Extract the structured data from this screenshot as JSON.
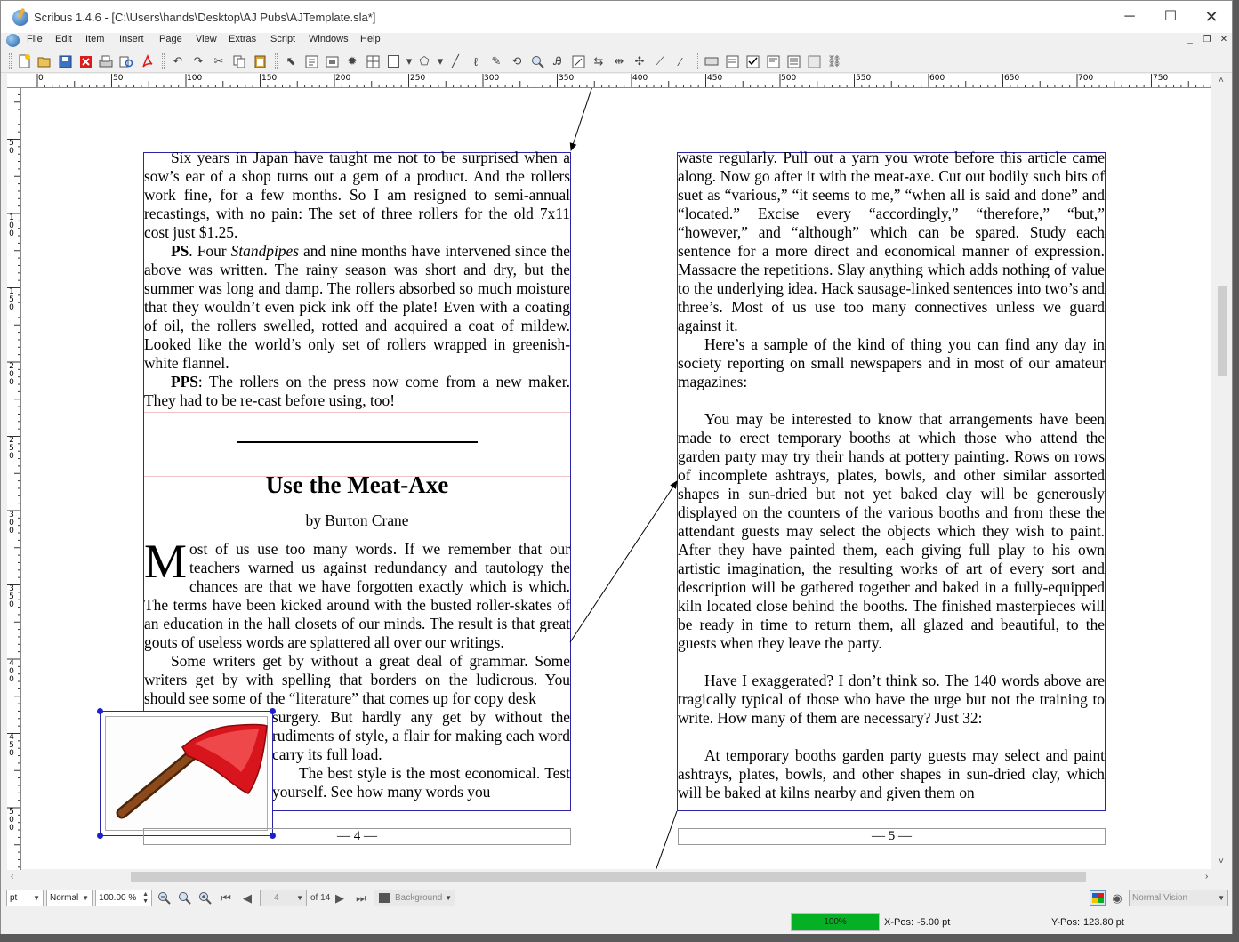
{
  "window": {
    "title": "Scribus 1.4.6 - [C:\\Users\\hands\\Desktop\\AJ Pubs\\AJTemplate.sla*]",
    "min": "─",
    "max": "☐",
    "close": "✕"
  },
  "menu": [
    "File",
    "Edit",
    "Item",
    "Insert",
    "Page",
    "View",
    "Extras",
    "Script",
    "Windows",
    "Help"
  ],
  "mdi": {
    "min": "_",
    "restore": "❐",
    "close": "✕"
  },
  "ruler": {
    "h_labels": [
      "0",
      "50",
      "100",
      "150",
      "200",
      "250",
      "300",
      "350",
      "400",
      "450",
      "500",
      "550",
      "600",
      "650",
      "700",
      "750"
    ],
    "v_labels": [
      "50",
      "100",
      "150",
      "200",
      "250",
      "300",
      "350",
      "400",
      "450",
      "500"
    ]
  },
  "page4": {
    "column1": [
      {
        "text": "Six years in Japan have taught me not to be surprised when a sow’s ear of a shop turns out a gem of a product. And the rollers work fine, for a few months. So I am resigned to semi-annual recastings, with no pain: The set of three rollers for the old 7x11 cost just $1.25."
      },
      {
        "lead": "PS",
        "pre": ". Four ",
        "em": "Standpipes",
        "post": " and nine months have intervened since the above was written. The rainy season was short and dry, but the summer was long and damp. The rollers absorbed so much moisture that they wouldn’t even pick ink off the plate! Even with a coating of oil, the rollers swelled, rotted and acquired a coat of mildew. Looked like the world’s only set of rollers wrapped in greenish-white flannel."
      },
      {
        "lead": "PPS",
        "pre": ": The rollers on the press now come from a new maker. They had to be re-cast before using, too!"
      }
    ],
    "article_title": "Use the Meat-Axe",
    "byline": "by Burton Crane",
    "dropcap": "M",
    "article_p1": "ost of us use too many words. If we remember that our teachers warned us against redundancy and tautology the chances are that we have forgotten exactly which is which. The terms have been kicked around with the busted roller-skates of an education in the hall closets of our minds. The result is that great gouts of useless words are splattered all over our writings.",
    "article_p2a": "Some writers get by without a great deal of grammar. Some writers get by with spelling that borders on the ludicrous. You should see some of the “literature” that comes up for copy desk",
    "article_p2b": "surgery. But hardly any get by without the rudiments of style, a flair for making each word carry its full load.",
    "article_p3": "The best style is the most economical. Test yourself. See how many words you",
    "page_number": "— 4 —"
  },
  "page5": {
    "paragraphs": [
      {
        "indent": false,
        "text": "waste regularly. Pull out a yarn you wrote before this article came along. Now go after it with the meat-axe. Cut out bodily such bits of suet as “various,” “it seems to me,” “when all is said and done” and “located.” Excise every “accordingly,” “therefore,” “but,” “however,” and “although” which can be spared. Study each sentence for a more direct and economical manner of expression. Massacre the repetitions. Slay anything which adds nothing of value to the underlying idea. Hack sausage-linked sentences into two’s and three’s. Most of us use too many connectives unless we guard against it."
      },
      {
        "indent": true,
        "text": "Here’s a sample of the kind of thing you can find any day in society reporting on small newspapers and in most of our amateur magazines:"
      },
      {
        "blank": true
      },
      {
        "indent": true,
        "text": "You may be interested to know that arrangements have been made to erect temporary booths at which those who attend the garden party may try their hands at pottery painting. Rows on rows of incomplete ashtrays, plates, bowls, and other similar assorted shapes in sun-dried but not yet baked clay will be generously displayed on the counters of the various booths and from these the attendant guests may select the objects which they wish to paint. After they have painted them, each giving full play to his own artistic imagination, the resulting works of art of every sort and description will be gathered together and baked in a fully-equipped kiln located close behind the booths. The finished masterpieces will be ready in time to return them, all glazed and beautiful, to the guests when they leave the party."
      },
      {
        "blank": true
      },
      {
        "indent": true,
        "text": "Have I exaggerated? I don’t think so. The 140 words above are tragically typical of those who have the urge but not the training to write. How many of them are necessary? Just 32:"
      },
      {
        "blank": true
      },
      {
        "indent": true,
        "text": "At temporary booths garden party guests may select and paint ashtrays, plates, bowls, and other shapes in sun-dried clay, which will be baked at kilns nearby and given them on"
      }
    ],
    "page_number": "— 5 —"
  },
  "bottom": {
    "unit": "pt",
    "mode": "Normal",
    "zoom": "100.00 %",
    "page": "4",
    "of_pages": "of 14",
    "layer": "Background",
    "vision": "Normal Vision"
  },
  "status": {
    "progress_text": "100%",
    "progress_value": 1.0,
    "xpos_label": "X-Pos:",
    "xpos_value": "-5.00 pt",
    "ypos_label": "Y-Pos:",
    "ypos_value": "123.80 pt"
  },
  "colors": {
    "frame": "#2c24a8",
    "margin": "#cc2233",
    "progress": "#06b025",
    "axe_red": "#d8141c",
    "handle_brown": "#7a3a12"
  }
}
